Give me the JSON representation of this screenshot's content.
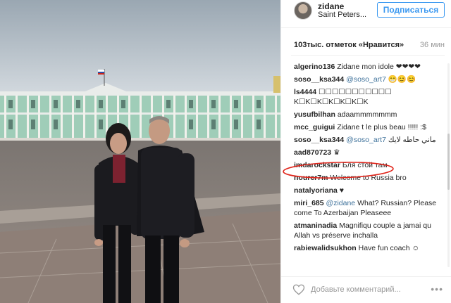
{
  "post": {
    "username": "zidane",
    "location": "Saint Peters...",
    "follow_label": "Подписаться",
    "likes": "103тыс. отметок «Нравится»",
    "time": "36 мин"
  },
  "comments": [
    {
      "user": "algerino136",
      "text": "Zidane mon idole",
      "trail": "❤❤❤❤"
    },
    {
      "user": "soso__ksa344",
      "mention": "@soso_art7",
      "text": "😁😊😊"
    },
    {
      "user": "ls4444",
      "text": "☐☐☐☐☐☐☐☐☐☐☐ K☐K☐K☐K☐K☐K☐K"
    },
    {
      "user": "yusufbilhan",
      "text": "adaammmmmmm"
    },
    {
      "user": "mcc_guigui",
      "text": "Zidane t le plus beau !!!!! :$"
    },
    {
      "user": "soso__ksa344",
      "mention": "@soso_art7",
      "text": "ماني حاطه لايك"
    },
    {
      "user": "aad870723",
      "text": "♛"
    },
    {
      "user": "imdarockstar",
      "text": "Бля стой там"
    },
    {
      "user": "nourcr7m",
      "text": "Welcome to Russia bro"
    },
    {
      "user": "natalyoriana",
      "text": "♥"
    },
    {
      "user": "miri_685",
      "mention": "@zidane",
      "text": "What? Russian? Please come To Azerbaijan Pleaseee"
    },
    {
      "user": "atmaninadia",
      "text": "Magnifiqu couple a jamai qu Allah vs préserve inchalla"
    },
    {
      "user": "rabiewalidsukhon",
      "text": "Have fun coach",
      "trail": "☺"
    }
  ],
  "footer": {
    "placeholder": "Добавьте комментарий...",
    "more": "•••",
    "heart_icon": "heart-outline-icon"
  },
  "colors": {
    "link": "#3897f0",
    "mention": "#3f729b",
    "annotation": "#e0251b"
  }
}
